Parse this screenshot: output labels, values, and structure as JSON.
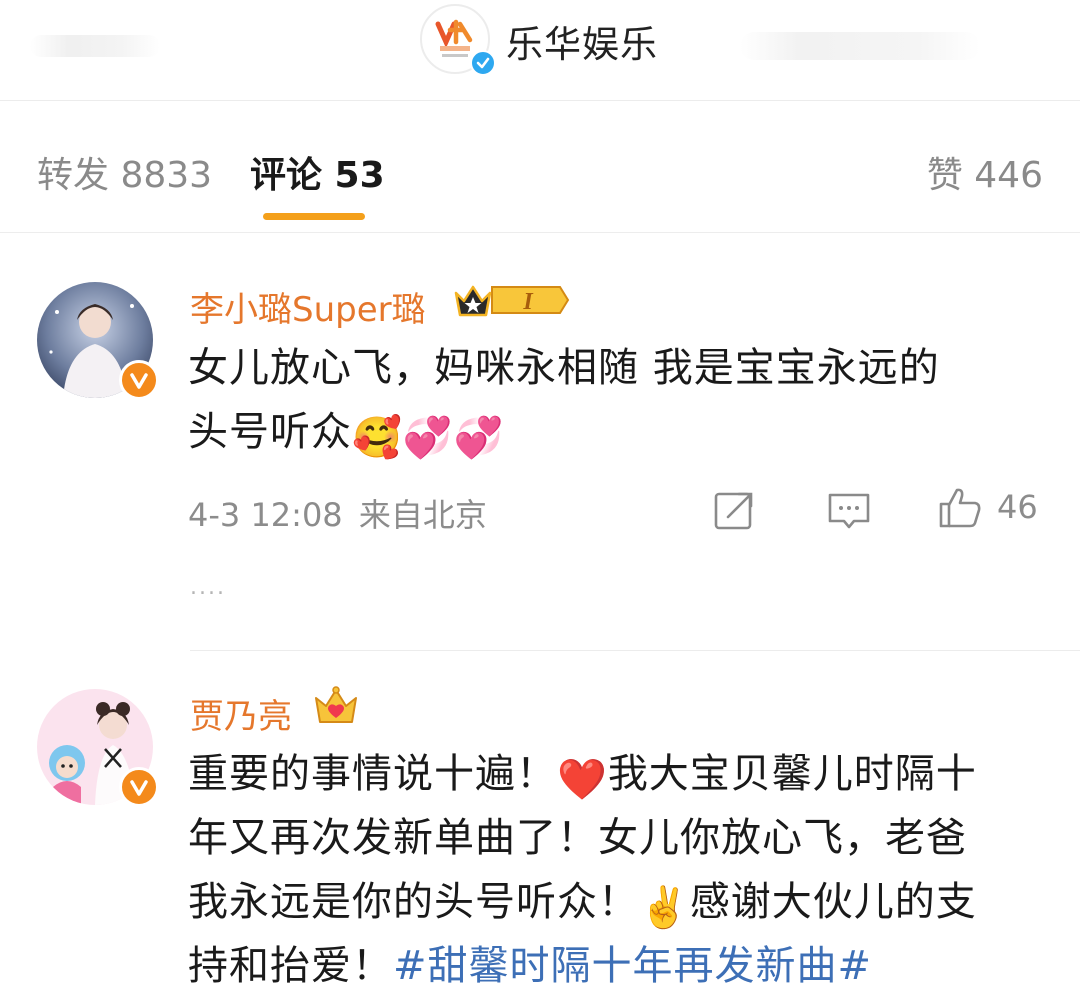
{
  "header": {
    "account_name": "乐华娱乐",
    "logo_icon": "yuehua-logo-icon",
    "verified_icon": "verified-blue-icon"
  },
  "tabs": {
    "forward": "转发 8833",
    "comments": "评论 53",
    "likes": "赞 446",
    "active_color": "#f4a01b"
  },
  "comments": [
    {
      "username": "李小璐Super璐",
      "badge_icon": "vip-crown-level-badge-icon",
      "badge_level": "I",
      "text_lines": [
        "女儿放心飞，妈咪永相随 我是宝宝永远的",
        "头号听众"
      ],
      "emojis": [
        "🥰",
        "💞",
        "💞"
      ],
      "time": "4-3 12:08",
      "location": "来自北京",
      "like_count": "46",
      "more": "....",
      "username_color": "#e5772c"
    },
    {
      "username": "贾乃亮",
      "badge_icon": "crown-heart-icon",
      "text_parts": {
        "line1": "重要的事情说十遍！",
        "heart": "❤️",
        "line1b": "我大宝贝馨儿时隔十",
        "line2": "年又再次发新单曲了！女儿你放心飞，老爸",
        "line3a": "我永远是你的头号听众！",
        "victory": "✌️",
        "line3b": "感谢大伙儿的支",
        "line4a": "持和抬爱！",
        "hashtag": "#甜馨时隔十年再发新曲#"
      },
      "hashtag_color": "#3d6fb6"
    }
  ]
}
